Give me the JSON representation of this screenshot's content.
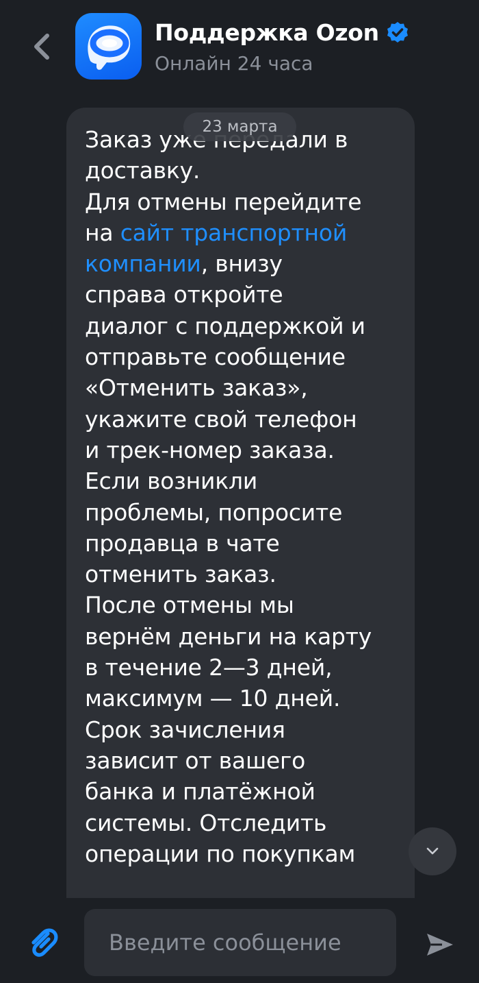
{
  "header": {
    "title": "Поддержка Ozon",
    "subtitle": "Онлайн 24 часа",
    "back_icon": "chevron-left-icon",
    "verified_icon": "verified-badge-icon"
  },
  "message": {
    "lines": [
      {
        "text": "Заказ уже передали в"
      },
      {
        "text": "доставку."
      },
      {
        "text": "Для отмены перейдите"
      },
      {
        "pre": "на ",
        "link": "сайт транспортной"
      },
      {
        "link": "компании",
        "post": ", внизу"
      },
      {
        "text": "справа откройте"
      },
      {
        "text": "диалог с поддержкой и"
      },
      {
        "text": "отправьте сообщение"
      },
      {
        "text": "«Отменить заказ»,"
      },
      {
        "text": "укажите свой телефон"
      },
      {
        "text": "и трек-номер заказа."
      },
      {
        "text": "Если возникли"
      },
      {
        "text": "проблемы, попросите"
      },
      {
        "text": "продавца в чате"
      },
      {
        "text": "отменить заказ."
      },
      {
        "text": "После отмены мы"
      },
      {
        "text": "вернём деньги на карту"
      },
      {
        "text": "в течение 2—3 дней,"
      },
      {
        "text": "максимум — 10 дней."
      },
      {
        "text": "Срок зачисления"
      },
      {
        "text": "зависит от вашего"
      },
      {
        "text": "банка и платёжной"
      },
      {
        "text": "системы. Отследить"
      },
      {
        "text": "операции по покупкам"
      }
    ]
  },
  "date_pill": "23 марта",
  "input": {
    "placeholder": "Введите сообщение",
    "value": ""
  },
  "colors": {
    "background": "#1c1f24",
    "bubble": "#2d3036",
    "link": "#1f8fff",
    "accent": "#0a6cff",
    "muted": "#8b9099"
  }
}
